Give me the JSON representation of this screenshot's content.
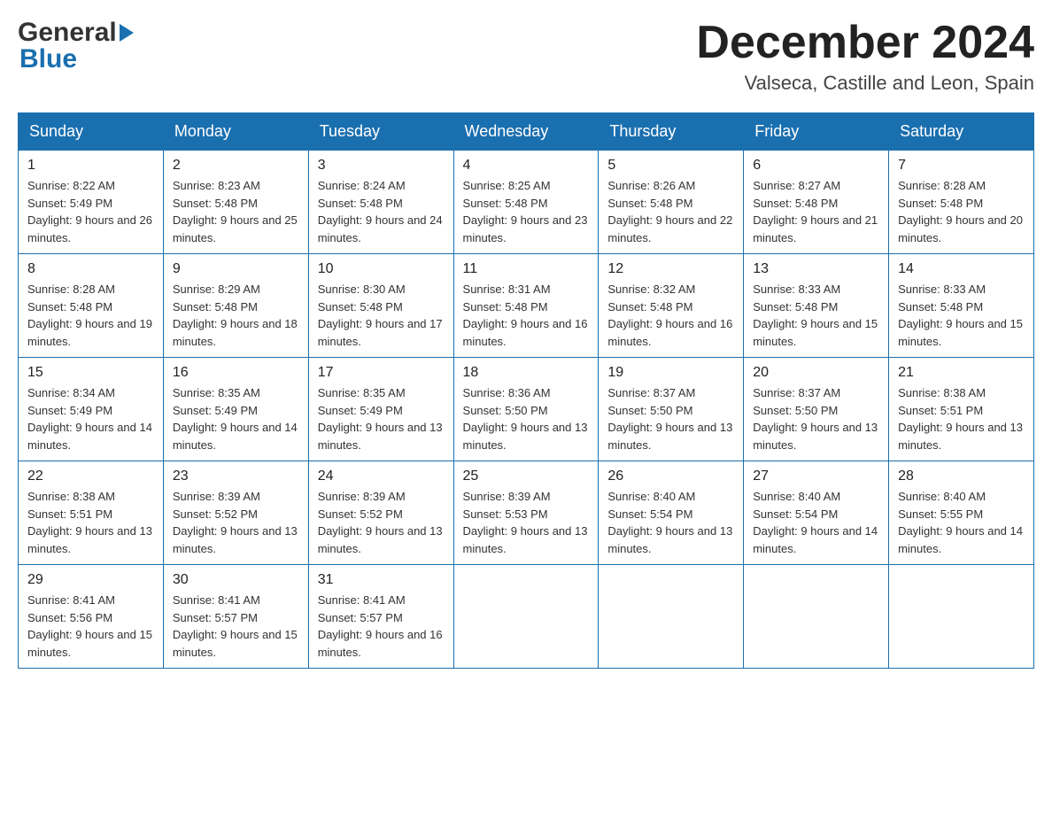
{
  "header": {
    "logo": {
      "general_text": "General",
      "blue_text": "Blue"
    },
    "month_title": "December 2024",
    "location": "Valseca, Castille and Leon, Spain"
  },
  "calendar": {
    "days_of_week": [
      "Sunday",
      "Monday",
      "Tuesday",
      "Wednesday",
      "Thursday",
      "Friday",
      "Saturday"
    ],
    "weeks": [
      [
        {
          "day": "1",
          "sunrise": "Sunrise: 8:22 AM",
          "sunset": "Sunset: 5:49 PM",
          "daylight": "Daylight: 9 hours and 26 minutes."
        },
        {
          "day": "2",
          "sunrise": "Sunrise: 8:23 AM",
          "sunset": "Sunset: 5:48 PM",
          "daylight": "Daylight: 9 hours and 25 minutes."
        },
        {
          "day": "3",
          "sunrise": "Sunrise: 8:24 AM",
          "sunset": "Sunset: 5:48 PM",
          "daylight": "Daylight: 9 hours and 24 minutes."
        },
        {
          "day": "4",
          "sunrise": "Sunrise: 8:25 AM",
          "sunset": "Sunset: 5:48 PM",
          "daylight": "Daylight: 9 hours and 23 minutes."
        },
        {
          "day": "5",
          "sunrise": "Sunrise: 8:26 AM",
          "sunset": "Sunset: 5:48 PM",
          "daylight": "Daylight: 9 hours and 22 minutes."
        },
        {
          "day": "6",
          "sunrise": "Sunrise: 8:27 AM",
          "sunset": "Sunset: 5:48 PM",
          "daylight": "Daylight: 9 hours and 21 minutes."
        },
        {
          "day": "7",
          "sunrise": "Sunrise: 8:28 AM",
          "sunset": "Sunset: 5:48 PM",
          "daylight": "Daylight: 9 hours and 20 minutes."
        }
      ],
      [
        {
          "day": "8",
          "sunrise": "Sunrise: 8:28 AM",
          "sunset": "Sunset: 5:48 PM",
          "daylight": "Daylight: 9 hours and 19 minutes."
        },
        {
          "day": "9",
          "sunrise": "Sunrise: 8:29 AM",
          "sunset": "Sunset: 5:48 PM",
          "daylight": "Daylight: 9 hours and 18 minutes."
        },
        {
          "day": "10",
          "sunrise": "Sunrise: 8:30 AM",
          "sunset": "Sunset: 5:48 PM",
          "daylight": "Daylight: 9 hours and 17 minutes."
        },
        {
          "day": "11",
          "sunrise": "Sunrise: 8:31 AM",
          "sunset": "Sunset: 5:48 PM",
          "daylight": "Daylight: 9 hours and 16 minutes."
        },
        {
          "day": "12",
          "sunrise": "Sunrise: 8:32 AM",
          "sunset": "Sunset: 5:48 PM",
          "daylight": "Daylight: 9 hours and 16 minutes."
        },
        {
          "day": "13",
          "sunrise": "Sunrise: 8:33 AM",
          "sunset": "Sunset: 5:48 PM",
          "daylight": "Daylight: 9 hours and 15 minutes."
        },
        {
          "day": "14",
          "sunrise": "Sunrise: 8:33 AM",
          "sunset": "Sunset: 5:48 PM",
          "daylight": "Daylight: 9 hours and 15 minutes."
        }
      ],
      [
        {
          "day": "15",
          "sunrise": "Sunrise: 8:34 AM",
          "sunset": "Sunset: 5:49 PM",
          "daylight": "Daylight: 9 hours and 14 minutes."
        },
        {
          "day": "16",
          "sunrise": "Sunrise: 8:35 AM",
          "sunset": "Sunset: 5:49 PM",
          "daylight": "Daylight: 9 hours and 14 minutes."
        },
        {
          "day": "17",
          "sunrise": "Sunrise: 8:35 AM",
          "sunset": "Sunset: 5:49 PM",
          "daylight": "Daylight: 9 hours and 13 minutes."
        },
        {
          "day": "18",
          "sunrise": "Sunrise: 8:36 AM",
          "sunset": "Sunset: 5:50 PM",
          "daylight": "Daylight: 9 hours and 13 minutes."
        },
        {
          "day": "19",
          "sunrise": "Sunrise: 8:37 AM",
          "sunset": "Sunset: 5:50 PM",
          "daylight": "Daylight: 9 hours and 13 minutes."
        },
        {
          "day": "20",
          "sunrise": "Sunrise: 8:37 AM",
          "sunset": "Sunset: 5:50 PM",
          "daylight": "Daylight: 9 hours and 13 minutes."
        },
        {
          "day": "21",
          "sunrise": "Sunrise: 8:38 AM",
          "sunset": "Sunset: 5:51 PM",
          "daylight": "Daylight: 9 hours and 13 minutes."
        }
      ],
      [
        {
          "day": "22",
          "sunrise": "Sunrise: 8:38 AM",
          "sunset": "Sunset: 5:51 PM",
          "daylight": "Daylight: 9 hours and 13 minutes."
        },
        {
          "day": "23",
          "sunrise": "Sunrise: 8:39 AM",
          "sunset": "Sunset: 5:52 PM",
          "daylight": "Daylight: 9 hours and 13 minutes."
        },
        {
          "day": "24",
          "sunrise": "Sunrise: 8:39 AM",
          "sunset": "Sunset: 5:52 PM",
          "daylight": "Daylight: 9 hours and 13 minutes."
        },
        {
          "day": "25",
          "sunrise": "Sunrise: 8:39 AM",
          "sunset": "Sunset: 5:53 PM",
          "daylight": "Daylight: 9 hours and 13 minutes."
        },
        {
          "day": "26",
          "sunrise": "Sunrise: 8:40 AM",
          "sunset": "Sunset: 5:54 PM",
          "daylight": "Daylight: 9 hours and 13 minutes."
        },
        {
          "day": "27",
          "sunrise": "Sunrise: 8:40 AM",
          "sunset": "Sunset: 5:54 PM",
          "daylight": "Daylight: 9 hours and 14 minutes."
        },
        {
          "day": "28",
          "sunrise": "Sunrise: 8:40 AM",
          "sunset": "Sunset: 5:55 PM",
          "daylight": "Daylight: 9 hours and 14 minutes."
        }
      ],
      [
        {
          "day": "29",
          "sunrise": "Sunrise: 8:41 AM",
          "sunset": "Sunset: 5:56 PM",
          "daylight": "Daylight: 9 hours and 15 minutes."
        },
        {
          "day": "30",
          "sunrise": "Sunrise: 8:41 AM",
          "sunset": "Sunset: 5:57 PM",
          "daylight": "Daylight: 9 hours and 15 minutes."
        },
        {
          "day": "31",
          "sunrise": "Sunrise: 8:41 AM",
          "sunset": "Sunset: 5:57 PM",
          "daylight": "Daylight: 9 hours and 16 minutes."
        },
        null,
        null,
        null,
        null
      ]
    ]
  }
}
